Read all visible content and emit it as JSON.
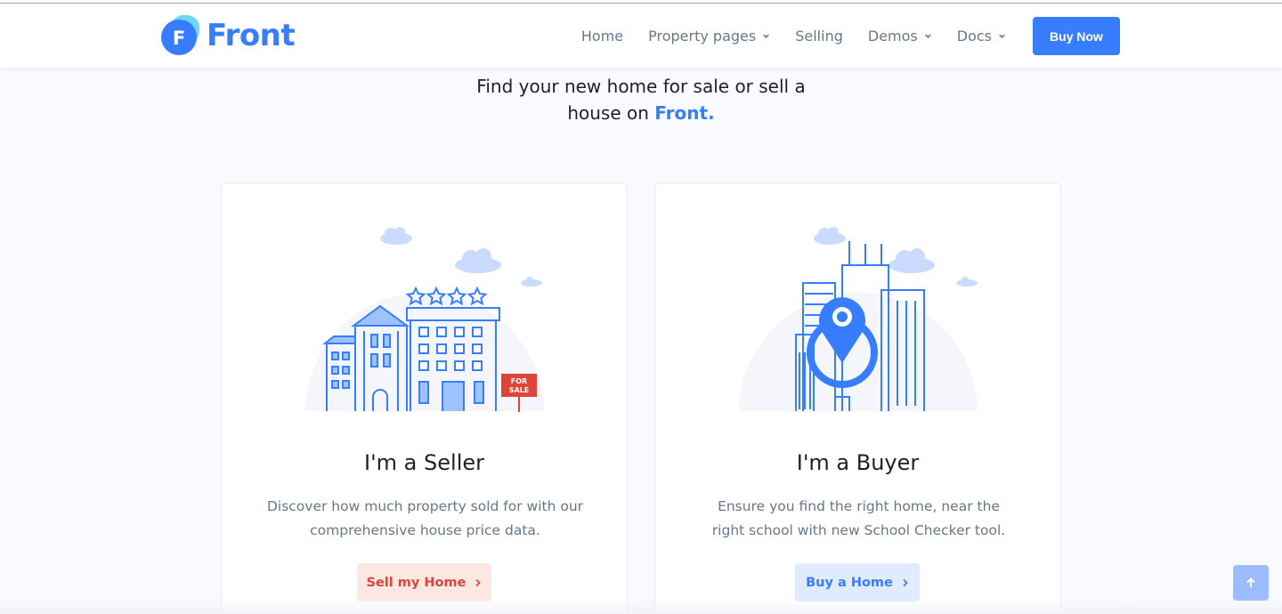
{
  "header": {
    "logo_text": "Front",
    "logo_letter": "F",
    "nav": [
      {
        "label": "Home",
        "dropdown": false
      },
      {
        "label": "Property pages",
        "dropdown": true
      },
      {
        "label": "Selling",
        "dropdown": false
      },
      {
        "label": "Demos",
        "dropdown": true
      },
      {
        "label": "Docs",
        "dropdown": true
      }
    ],
    "buy_label": "Buy Now"
  },
  "hero": {
    "line1": "Find your new home for sale or sell a",
    "line2_prefix": "house on ",
    "line2_brand": "Front."
  },
  "cards": {
    "seller": {
      "title": "I'm a Seller",
      "description": "Discover how much property sold for with our comprehensive house price data.",
      "button_label": "Sell my Home",
      "sign_line1": "FOR",
      "sign_line2": "SALE"
    },
    "buyer": {
      "title": "I'm a Buyer",
      "description": "Ensure you find the right home, near the right school with new School Checker tool.",
      "button_label": "Buy a Home"
    }
  },
  "colors": {
    "primary": "#377dff",
    "danger": "#de4437",
    "muted": "#677788"
  },
  "icons": {
    "scroll_top": "arrow-up-icon",
    "caret": "chevron-down-icon",
    "button_arrow": "chevron-right-icon"
  }
}
